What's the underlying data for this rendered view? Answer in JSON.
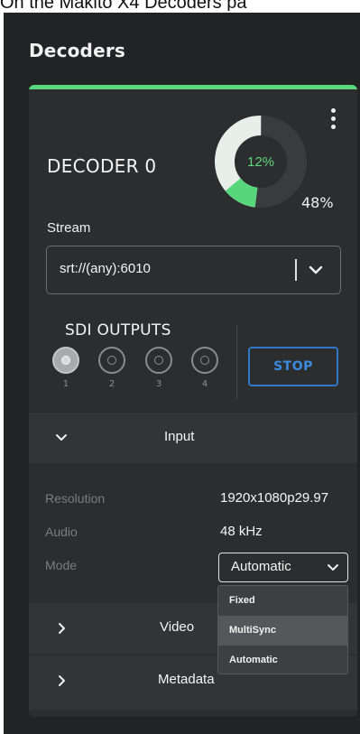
{
  "caption": "On the Makito X4 Decoders pa",
  "panel": {
    "title": "Decoders"
  },
  "decoder": {
    "name": "DECODER 0",
    "usage_inner": "12%",
    "usage_outer": "48%",
    "usage_inner_value": 0.12,
    "usage_outer_value": 0.48,
    "accent_color": "#57d67b",
    "menu_icon": "kebab-menu-icon"
  },
  "stream": {
    "label": "Stream",
    "value": "srt://(any):6010",
    "dropdown_icon": "chevron-down-icon"
  },
  "sdi": {
    "label": "SDI OUTPUTS",
    "ports": [
      {
        "num": "1",
        "active": true
      },
      {
        "num": "2",
        "active": false
      },
      {
        "num": "3",
        "active": false
      },
      {
        "num": "4",
        "active": false
      }
    ],
    "stop_label": "STOP",
    "stop_color": "#2f78c8"
  },
  "sections": {
    "input": "Input",
    "video": "Video",
    "metadata": "Metadata"
  },
  "input_details": {
    "resolution_label": "Resolution",
    "resolution_value": "1920x1080p29.97",
    "audio_label": "Audio",
    "audio_value": "48 kHz",
    "mode_label": "Mode",
    "mode_value": "Automatic"
  },
  "mode_options": [
    "Fixed",
    "MultiSync",
    "Automatic"
  ],
  "mode_highlighted": "MultiSync"
}
